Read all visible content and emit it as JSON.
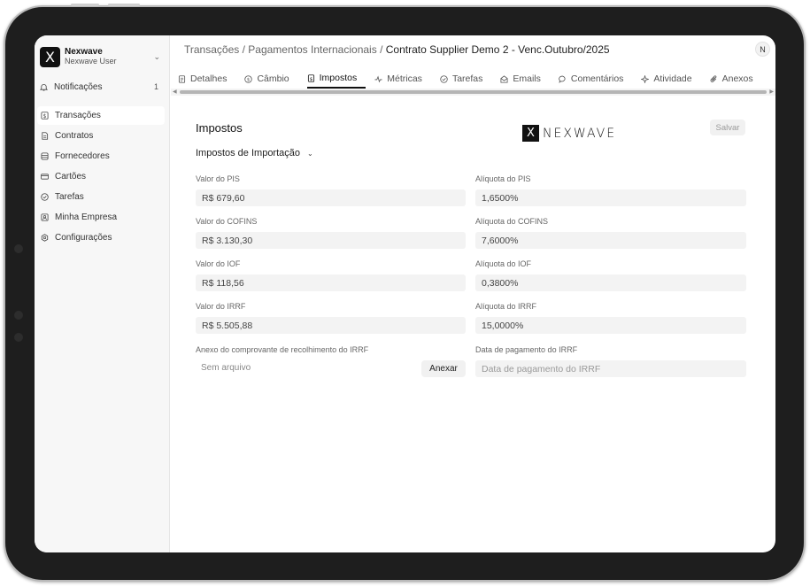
{
  "sidebar": {
    "brand_name": "Nexwave",
    "brand_user": "Nexwave User",
    "logo_letter": "X",
    "notifications_label": "Notificações",
    "notifications_count": "1",
    "items": [
      {
        "label": "Transações",
        "icon": "dollar-doc-icon",
        "active": true
      },
      {
        "label": "Contratos",
        "icon": "document-icon",
        "active": false
      },
      {
        "label": "Fornecedores",
        "icon": "database-icon",
        "active": false
      },
      {
        "label": "Cartões",
        "icon": "card-icon",
        "active": false
      },
      {
        "label": "Tarefas",
        "icon": "check-circle-icon",
        "active": false
      },
      {
        "label": "Minha Empresa",
        "icon": "company-icon",
        "active": false
      },
      {
        "label": "Configurações",
        "icon": "gear-icon",
        "active": false
      }
    ]
  },
  "header": {
    "breadcrumb_1": "Transações",
    "breadcrumb_2": "Pagamentos Internacionais",
    "breadcrumb_current": "Contrato Supplier Demo 2 - Venc.Outubro/2025",
    "separator": "/",
    "avatar_letter": "N"
  },
  "tabs": [
    {
      "label": "Detalhes",
      "icon": "doc-lines-icon",
      "active": false
    },
    {
      "label": "Câmbio",
      "icon": "dollar-circle-icon",
      "active": false
    },
    {
      "label": "Impostos",
      "icon": "dollar-doc-icon",
      "active": true
    },
    {
      "label": "Métricas",
      "icon": "activity-icon",
      "active": false
    },
    {
      "label": "Tarefas",
      "icon": "check-circle-icon",
      "active": false
    },
    {
      "label": "Emails",
      "icon": "mail-icon",
      "active": false
    },
    {
      "label": "Comentários",
      "icon": "comment-icon",
      "active": false
    },
    {
      "label": "Atividade",
      "icon": "sparkle-icon",
      "active": false
    },
    {
      "label": "Anexos",
      "icon": "paperclip-icon",
      "active": false
    }
  ],
  "content": {
    "title": "Impostos",
    "save_label": "Salvar",
    "watermark_letter": "X",
    "watermark_text": "NEXWAVE",
    "group_title": "Impostos de Importação",
    "fields_left": [
      {
        "label": "Valor do PIS",
        "value": "R$ 679,60"
      },
      {
        "label": "Valor do COFINS",
        "value": "R$ 3.130,30"
      },
      {
        "label": "Valor do IOF",
        "value": "R$ 118,56"
      },
      {
        "label": "Valor do IRRF",
        "value": "R$ 5.505,88"
      }
    ],
    "fields_right": [
      {
        "label": "Alíquota do PIS",
        "value": "1,6500%"
      },
      {
        "label": "Alíquota do COFINS",
        "value": "7,6000%"
      },
      {
        "label": "Alíquota do IOF",
        "value": "0,3800%"
      },
      {
        "label": "Alíquota do IRRF",
        "value": "15,0000%"
      }
    ],
    "attachment_label": "Anexo do comprovante de recolhimento do IRRF",
    "attachment_value": "Sem arquivo",
    "attach_button": "Anexar",
    "payment_date_label": "Data de pagamento do IRRF",
    "payment_date_placeholder": "Data de pagamento do IRRF"
  }
}
